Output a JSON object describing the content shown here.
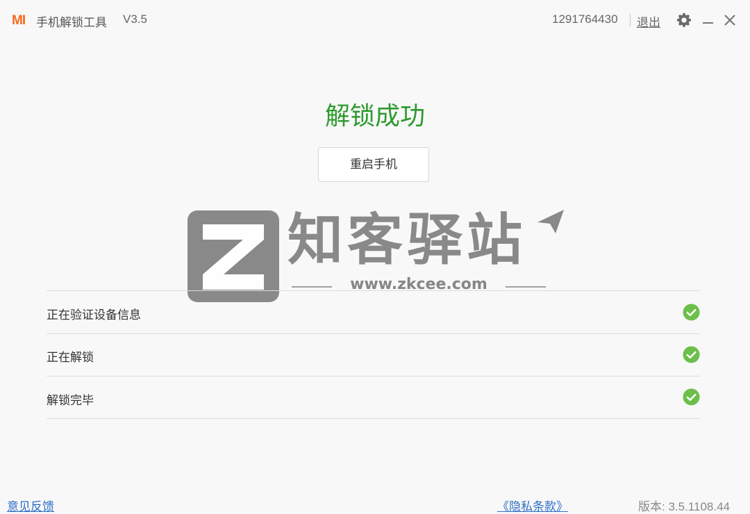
{
  "titlebar": {
    "logo_text": "MI",
    "app_title": "手机解锁工具",
    "version": "V3.5",
    "account_id": "1291764430",
    "logout_label": "退出",
    "icons": [
      "gear-icon",
      "minimize-icon",
      "close-icon"
    ]
  },
  "main": {
    "success_title": "解锁成功",
    "restart_button_label": "重启手机"
  },
  "watermark": {
    "brand_text": "知客驿站",
    "url_text": "www.zkcee.com"
  },
  "steps": [
    {
      "label": "正在验证设备信息",
      "status": "done",
      "icon": "check-circle-icon"
    },
    {
      "label": "正在解锁",
      "status": "done",
      "icon": "check-circle-icon"
    },
    {
      "label": "解锁完毕",
      "status": "done",
      "icon": "check-circle-icon"
    }
  ],
  "footer": {
    "feedback_label": "意见反馈",
    "privacy_label": "《隐私条款》",
    "version_label": "版本: 3.5.1108.44"
  },
  "colors": {
    "brand_orange": "#f56b1e",
    "success_green": "#2e9a2e",
    "check_green": "#6cbf4a",
    "link_blue": "#2f6fc6",
    "background": "#f8f8f8"
  }
}
